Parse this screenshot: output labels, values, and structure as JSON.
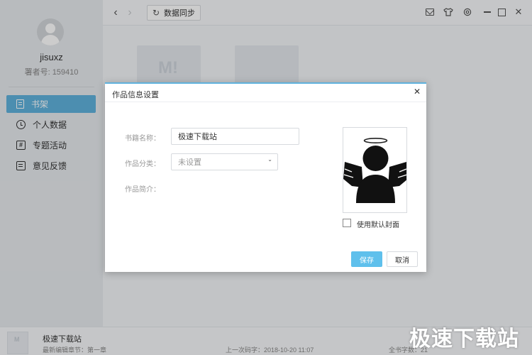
{
  "profile": {
    "username": "jisuxz",
    "author_id": "署者号: 159410"
  },
  "sidebar": {
    "items": [
      {
        "label": "书架",
        "icon": "book-icon",
        "active": true
      },
      {
        "label": "个人数据",
        "icon": "clock-icon",
        "active": false
      },
      {
        "label": "专题活动",
        "icon": "hash-icon",
        "active": false
      },
      {
        "label": "意见反馈",
        "icon": "feedback-icon",
        "active": false
      }
    ]
  },
  "toolbar": {
    "back": "‹",
    "forward": "›",
    "sync_label": "数据同步",
    "sync_icon": "↻",
    "close": "✕"
  },
  "bookshelf": {
    "cover_mark": "M!"
  },
  "modal": {
    "title": "作品信息设置",
    "close": "✕",
    "name_label": "书籍名称：",
    "name_value": "极速下载站",
    "category_label": "作品分类：",
    "category_value": "未设置",
    "category_chevron": "⌄",
    "intro_label": "作品简介：",
    "use_default_cover_label": "使用默认封面",
    "use_default_cover_checked": false,
    "save_label": "保存",
    "cancel_label": "取消"
  },
  "bottom": {
    "book_name": "极速下载站",
    "latest_chapter": "最新编辑章节：第一章",
    "last_upload": "上一次码字：2018-10-20 11:07",
    "total_words": "全书字数：21",
    "cover_mark": "M"
  },
  "watermark": "极速下载站",
  "colors": {
    "accent": "#5fb2dd",
    "save_button": "#5fc0ec"
  }
}
